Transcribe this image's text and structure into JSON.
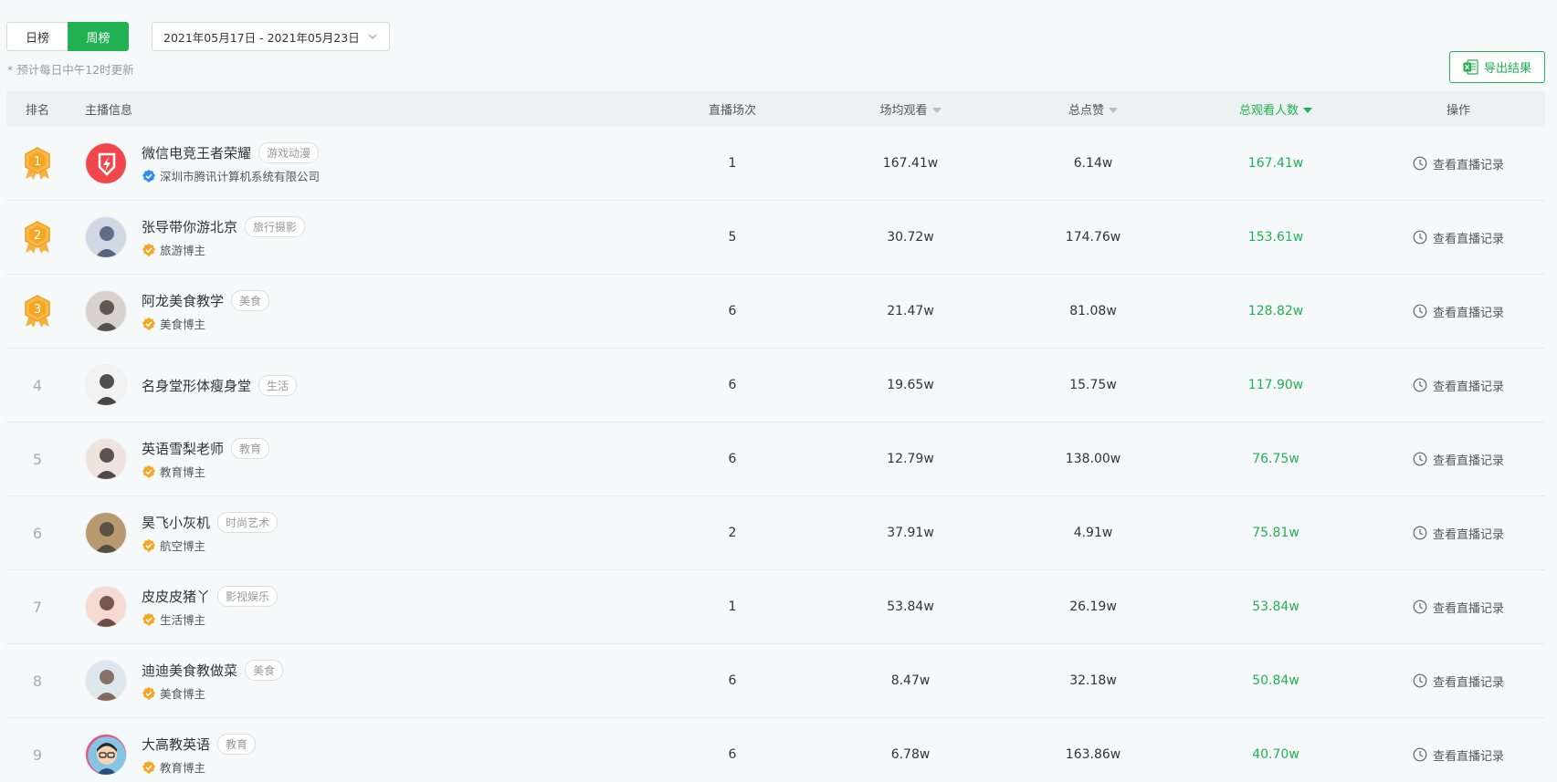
{
  "tabs": {
    "daily": "日榜",
    "weekly": "周榜"
  },
  "date_range": "2021年05月17日 - 2021年05月23日",
  "update_note": "* 预计每日中午12时更新",
  "export_label": "导出结果",
  "headers": {
    "rank": "排名",
    "host": "主播信息",
    "sessions": "直播场次",
    "avg_views": "场均观看",
    "total_likes": "总点赞",
    "total_viewers": "总观看人数",
    "action": "操作"
  },
  "colors": {
    "accent": "#21b152",
    "medal": "#f5a623"
  },
  "rows": [
    {
      "rank": "1",
      "name": "微信电竞王者荣耀",
      "tag": "游戏动漫",
      "verify": "深圳市腾讯计算机系统有限公司",
      "verify_type": "blue",
      "sessions": "1",
      "avg_views": "167.41w",
      "likes": "6.14w",
      "viewers": "167.41w",
      "action": "查看直播记录"
    },
    {
      "rank": "2",
      "name": "张导带你游北京",
      "tag": "旅行摄影",
      "verify": "旅游博主",
      "verify_type": "gold",
      "sessions": "5",
      "avg_views": "30.72w",
      "likes": "174.76w",
      "viewers": "153.61w",
      "action": "查看直播记录"
    },
    {
      "rank": "3",
      "name": "阿龙美食教学",
      "tag": "美食",
      "verify": "美食博主",
      "verify_type": "gold",
      "sessions": "6",
      "avg_views": "21.47w",
      "likes": "81.08w",
      "viewers": "128.82w",
      "action": "查看直播记录"
    },
    {
      "rank": "4",
      "name": "名身堂形体瘦身堂",
      "tag": "生活",
      "verify": "",
      "verify_type": "none",
      "sessions": "6",
      "avg_views": "19.65w",
      "likes": "15.75w",
      "viewers": "117.90w",
      "action": "查看直播记录"
    },
    {
      "rank": "5",
      "name": "英语雪梨老师",
      "tag": "教育",
      "verify": "教育博主",
      "verify_type": "gold",
      "sessions": "6",
      "avg_views": "12.79w",
      "likes": "138.00w",
      "viewers": "76.75w",
      "action": "查看直播记录"
    },
    {
      "rank": "6",
      "name": "昊飞小灰机",
      "tag": "时尚艺术",
      "verify": "航空博主",
      "verify_type": "gold",
      "sessions": "2",
      "avg_views": "37.91w",
      "likes": "4.91w",
      "viewers": "75.81w",
      "action": "查看直播记录"
    },
    {
      "rank": "7",
      "name": "皮皮皮猪丫",
      "tag": "影视娱乐",
      "verify": "生活博主",
      "verify_type": "gold",
      "sessions": "1",
      "avg_views": "53.84w",
      "likes": "26.19w",
      "viewers": "53.84w",
      "action": "查看直播记录"
    },
    {
      "rank": "8",
      "name": "迪迪美食教做菜",
      "tag": "美食",
      "verify": "美食博主",
      "verify_type": "gold",
      "sessions": "6",
      "avg_views": "8.47w",
      "likes": "32.18w",
      "viewers": "50.84w",
      "action": "查看直播记录"
    },
    {
      "rank": "9",
      "name": "大高教英语",
      "tag": "教育",
      "verify": "教育博主",
      "verify_type": "gold",
      "sessions": "6",
      "avg_views": "6.78w",
      "likes": "163.86w",
      "viewers": "40.70w",
      "action": "查看直播记录"
    }
  ]
}
